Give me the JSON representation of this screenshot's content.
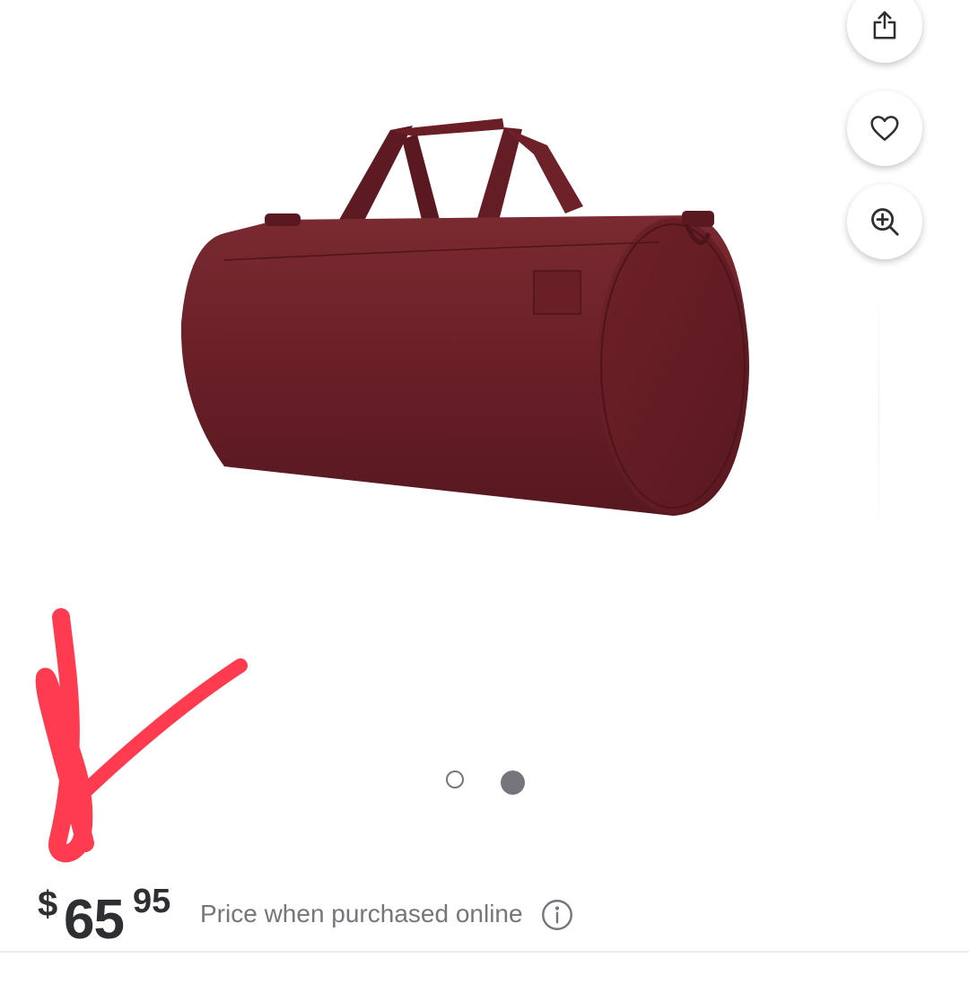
{
  "gallery": {
    "image_name": "maroon-duffel-bag",
    "active_index": 2,
    "total": 2
  },
  "actions": {
    "share_icon": "share-icon",
    "favorite_icon": "heart-icon",
    "zoom_icon": "zoom-in-icon"
  },
  "price": {
    "currency": "$",
    "whole": "65",
    "cents": "95",
    "note": "Price when purchased online",
    "info_icon": "info-icon"
  },
  "colors": {
    "bag": "#6e1f27",
    "text_dark": "#2e2f32",
    "text_gray": "#74767c",
    "scribble": "#ff3b4f"
  }
}
